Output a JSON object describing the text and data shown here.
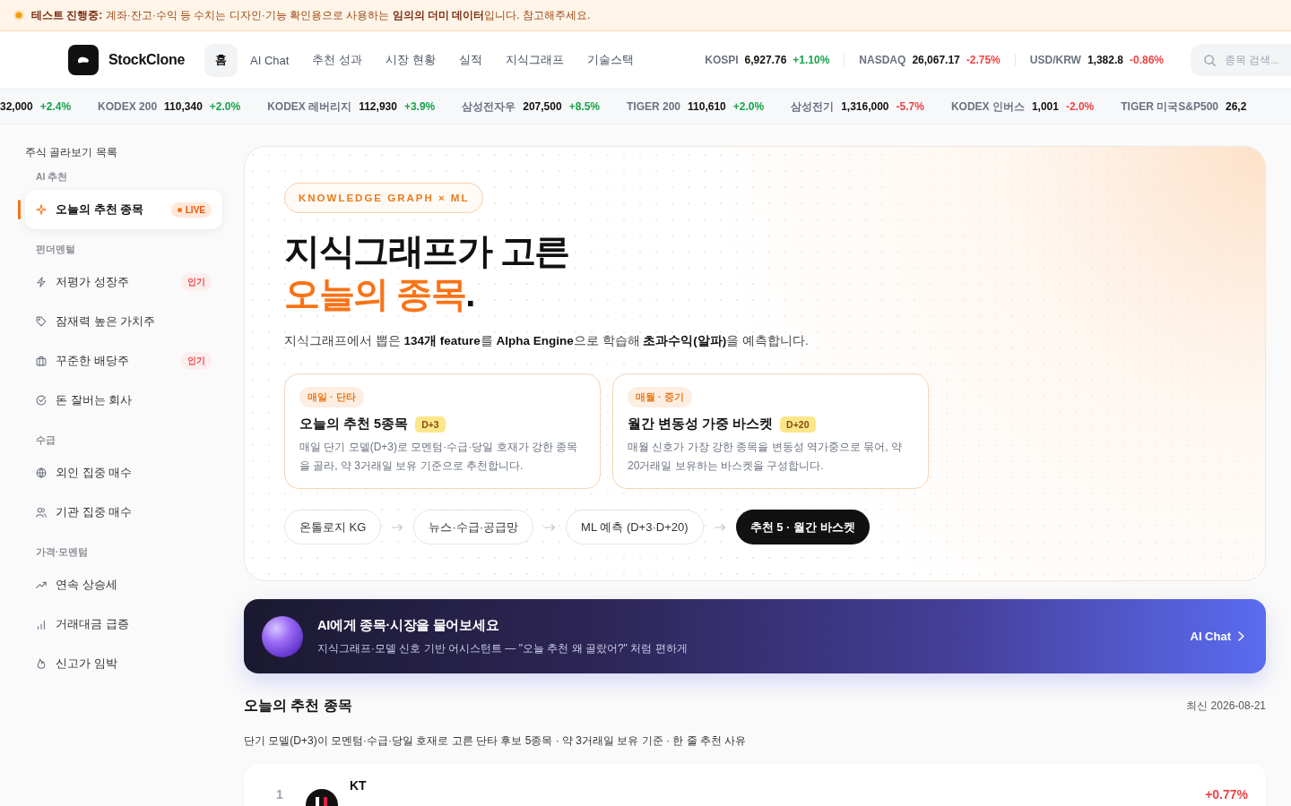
{
  "notice": {
    "text": "**테스트 진행중:** 계좌·잔고·수익 등 수치는 디자인·기능 확인용으로 사용하는 **임의의 더미 데이터**입니다. 참고해주세요."
  },
  "header": {
    "app_name": "StockClone",
    "nav": [
      {
        "label": "홈",
        "selected": true
      },
      {
        "label": "AI Chat",
        "selected": false
      },
      {
        "label": "추천 성과",
        "selected": false
      },
      {
        "label": "시장 현황",
        "selected": false
      },
      {
        "label": "실적",
        "selected": false
      },
      {
        "label": "지식그래프",
        "selected": false
      },
      {
        "label": "기술스택",
        "selected": false
      }
    ],
    "indices": [
      {
        "name": "KOSPI",
        "value": "6,927.76",
        "change": "+1.10%",
        "up": true
      },
      {
        "name": "NASDAQ",
        "value": "26,067.17",
        "change": "-2.75%",
        "up": false
      },
      {
        "name": "USD/KRW",
        "value": "1,382.8",
        "change": "-0.86%",
        "up": false
      }
    ],
    "search": {
      "placeholder": "종목 검색..."
    }
  },
  "ticker": [
    {
      "value": "32,000",
      "change": "+2.4%",
      "up": true
    },
    {
      "name": "KODEX 200",
      "value": "110,340",
      "change": "+2.0%",
      "up": true
    },
    {
      "name": "KODEX 레버리지",
      "value": "112,930",
      "change": "+3.9%",
      "up": true
    },
    {
      "name": "삼성전자우",
      "value": "207,500",
      "change": "+8.5%",
      "up": true
    },
    {
      "name": "TIGER 200",
      "value": "110,610",
      "change": "+2.0%",
      "up": true
    },
    {
      "name": "삼성전기",
      "value": "1,316,000",
      "change": "-5.7%",
      "up": false
    },
    {
      "name": "KODEX 인버스",
      "value": "1,001",
      "change": "-2.0%",
      "up": false
    },
    {
      "name": "TIGER 미국S&P500",
      "value": "26,2"
    }
  ],
  "sidebar": {
    "title": "주식 골라보기 목록",
    "sections": [
      {
        "label": "AI 추천",
        "items": [
          {
            "label": "오늘의 추천 종목",
            "selected": true,
            "badge": {
              "text": "LIVE",
              "kind": "live"
            }
          }
        ]
      },
      {
        "label": "펀더멘털",
        "items": [
          {
            "label": "저평가 성장주",
            "selected": false,
            "badge": {
              "text": "인기",
              "kind": "popular"
            }
          },
          {
            "label": "잠재력 높은 가치주",
            "selected": false
          },
          {
            "label": "꾸준한 배당주",
            "selected": false,
            "badge": {
              "text": "인기",
              "kind": "popular"
            }
          },
          {
            "label": "돈 잘버는 회사",
            "selected": false
          }
        ]
      },
      {
        "label": "수급",
        "items": [
          {
            "label": "외인 집중 매수",
            "selected": false
          },
          {
            "label": "기관 집중 매수",
            "selected": false
          }
        ]
      },
      {
        "label": "가격·모멘텀",
        "items": [
          {
            "label": "연속 상승세",
            "selected": false
          },
          {
            "label": "거래대금 급증",
            "selected": false
          },
          {
            "label": "신고가 임박",
            "selected": false
          }
        ]
      }
    ]
  },
  "hero": {
    "tag": "KNOWLEDGE GRAPH × ML",
    "headline": {
      "line1": "지식그래프가 고른",
      "accent": "오늘의 종목",
      "end": "."
    },
    "description": "지식그래프에서 뽑은 **134개 feature**를 **Alpha Engine**으로 학습해 **초과수익(알파)**을 예측합니다.",
    "cards": [
      {
        "tag": "매일 · 단타",
        "title": "오늘의 추천 5종목",
        "badge": "D+3",
        "description": "매일 단기 모델(D+3)로 모멘텀·수급·당일 호재가 강한 종목을 골라, 약 3거래일 보유 기준으로 추천합니다."
      },
      {
        "tag": "매월 · 중기",
        "title": "월간 변동성 가중 바스켓",
        "badge": "D+20",
        "description": "매월 신호가 가장 강한 종목을 변동성 역가중으로 묶어, 약 20거래일 보유하는 바스켓을 구성합니다."
      }
    ],
    "pipeline": [
      {
        "label": "온톨로지 KG",
        "kind": "step"
      },
      {
        "label": "뉴스·수급·공급망",
        "kind": "step"
      },
      {
        "label": "ML 예측 (D+3·D+20)",
        "kind": "step"
      },
      {
        "label": "추천 5 · 월간 바스켓",
        "kind": "result"
      }
    ]
  },
  "ai_banner": {
    "title": "AI에게 종목·시장을 물어보세요",
    "subtitle": "지식그래프·모델 신호 기반 어시스턴트 — \"오늘 추천 왜 골랐어?\" 처럼 편하게",
    "link": "AI Chat"
  },
  "recommendations": {
    "title": "오늘의 추천 종목",
    "updated": "최신 2026-08-21",
    "description": "단기 모델(D+3)이 모멘텀·수급·당일 호재로 고른 단타 후보 5종목 · 약 3거래일 보유 기준 · 한 줄 추천 사유",
    "rows": [
      {
        "rank": "1",
        "name": "KT",
        "change": "+0.77%",
        "up": true
      }
    ]
  }
}
